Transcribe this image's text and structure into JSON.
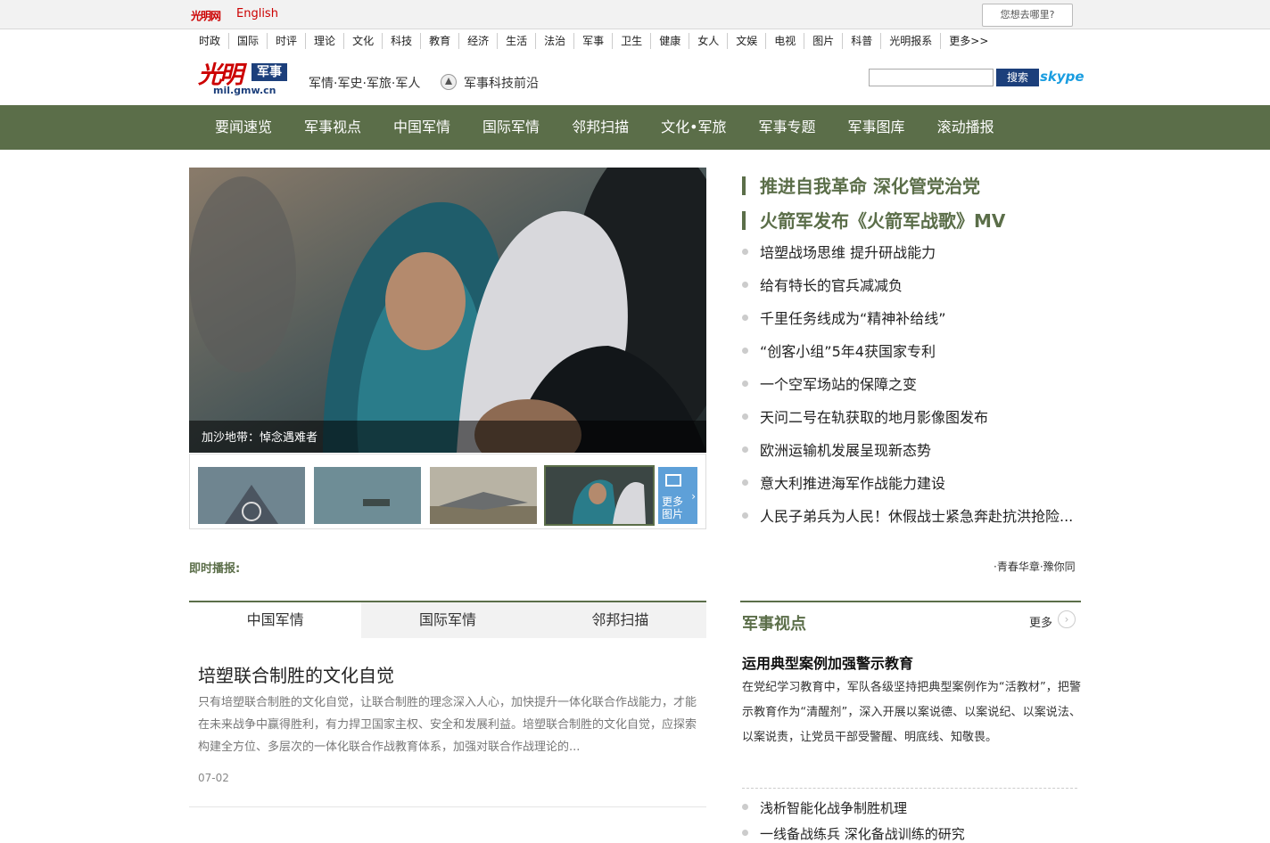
{
  "topbar": {
    "site_logo": "光明网",
    "english": "English",
    "where_to": "您想去哪里?"
  },
  "channels": [
    "时政",
    "国际",
    "时评",
    "理论",
    "文化",
    "科技",
    "教育",
    "经济",
    "生活",
    "法治",
    "军事",
    "卫生",
    "健康",
    "女人",
    "文娱",
    "电视",
    "图片",
    "科普",
    "光明报系",
    "更多>>"
  ],
  "header": {
    "logo_text": "光明",
    "logo_badge": "军事",
    "domain": "mil.gmw.cn",
    "slogan": "军情·军史·军旅·军人",
    "tech_link": "军事科技前沿",
    "search_button": "搜索",
    "search_placeholder": "",
    "skype": "skype"
  },
  "main_nav": [
    "要闻速览",
    "军事视点",
    "中国军情",
    "国际军情",
    "邻邦扫描",
    "文化•军旅",
    "军事专题",
    "军事图库",
    "滚动播报"
  ],
  "hero": {
    "caption": "加沙地带：悼念遇难者"
  },
  "more_pics": "更多图片",
  "headlines": [
    "推进自我革命 深化管党治党",
    "火箭军发布《火箭军战歌》MV"
  ],
  "news": [
    "培塑战场思维 提升研战能力",
    "给有特长的官兵减减负",
    "千里任务线成为“精神补给线”",
    "“创客小组”5年4获国家专利",
    "一个空军场站的保障之变",
    "天问二号在轨获取的地月影像图发布",
    "欧洲运输机发展呈现新态势",
    "意大利推进海军作战能力建设",
    "人民子弟兵为人民！休假战士紧急奔赴抗洪抢险..."
  ],
  "ticker": {
    "label": "即时播报:",
    "text": "·青春华章·豫你同"
  },
  "tabs": [
    "中国军情",
    "国际军情",
    "邻邦扫描"
  ],
  "article": {
    "title": "培塑联合制胜的文化自觉",
    "body": "只有培塑联合制胜的文化自觉，让联合制胜的理念深入人心，加快提升一体化联合作战能力，才能在未来战争中赢得胜利，有力捍卫国家主权、安全和发展利益。培塑联合制胜的文化自觉，应探索构建全方位、多层次的一体化联合作战教育体系，加强对联合作战理论的...",
    "date": "07-02"
  },
  "viewpoint": {
    "title": "军事视点",
    "more": "更多",
    "lead_title": "运用典型案例加强警示教育",
    "lead_body": "在党纪学习教育中，军队各级坚持把典型案例作为“活教材”，把警示教育作为“清醒剂”，深入开展以案说德、以案说纪、以案说法、以案说责，让党员干部受警醒、明底线、知敬畏。",
    "items": [
      "浅析智能化战争制胜机理",
      "一线备战练兵 深化备战训练的研究"
    ]
  }
}
